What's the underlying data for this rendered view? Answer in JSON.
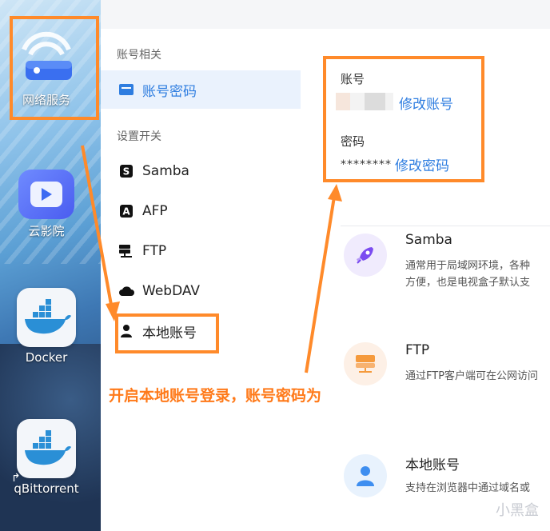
{
  "desktop": {
    "apps": [
      {
        "label": "网络服务",
        "icon": "network-service-icon"
      },
      {
        "label": "云影院",
        "icon": "play-icon"
      },
      {
        "label": "Docker",
        "icon": "docker-icon"
      },
      {
        "label": "qBittorrent",
        "icon": "docker-icon"
      }
    ]
  },
  "sidebar": {
    "section_account": "账号相关",
    "account_item": "账号密码",
    "section_switch": "设置开关",
    "items": [
      {
        "label": "Samba",
        "icon": "samba-icon"
      },
      {
        "label": "AFP",
        "icon": "afp-icon"
      },
      {
        "label": "FTP",
        "icon": "ftp-icon"
      },
      {
        "label": "WebDAV",
        "icon": "cloud-icon"
      },
      {
        "label": "本地账号",
        "icon": "user-icon"
      }
    ]
  },
  "main": {
    "account_label": "账号",
    "account_edit": "修改账号",
    "password_label": "密码",
    "password_value": "********",
    "password_edit": "修改密码",
    "cards": [
      {
        "title": "Samba",
        "desc1": "通常用于局域网环境，各种",
        "desc2": "方便，也是电视盒子默认支",
        "icon": "rocket-icon"
      },
      {
        "title": "FTP",
        "desc1": "通过FTP客户端可在公网访问",
        "icon": "ftp-server-icon"
      },
      {
        "title": "本地账号",
        "desc1": "支持在浏览器中通过域名或",
        "icon": "user-icon"
      }
    ]
  },
  "annotation": "开启本地账号登录，账号密码为",
  "watermark": "小黑盒",
  "colors": {
    "accent": "#2e7de0",
    "annotation": "#ff8a2a"
  }
}
